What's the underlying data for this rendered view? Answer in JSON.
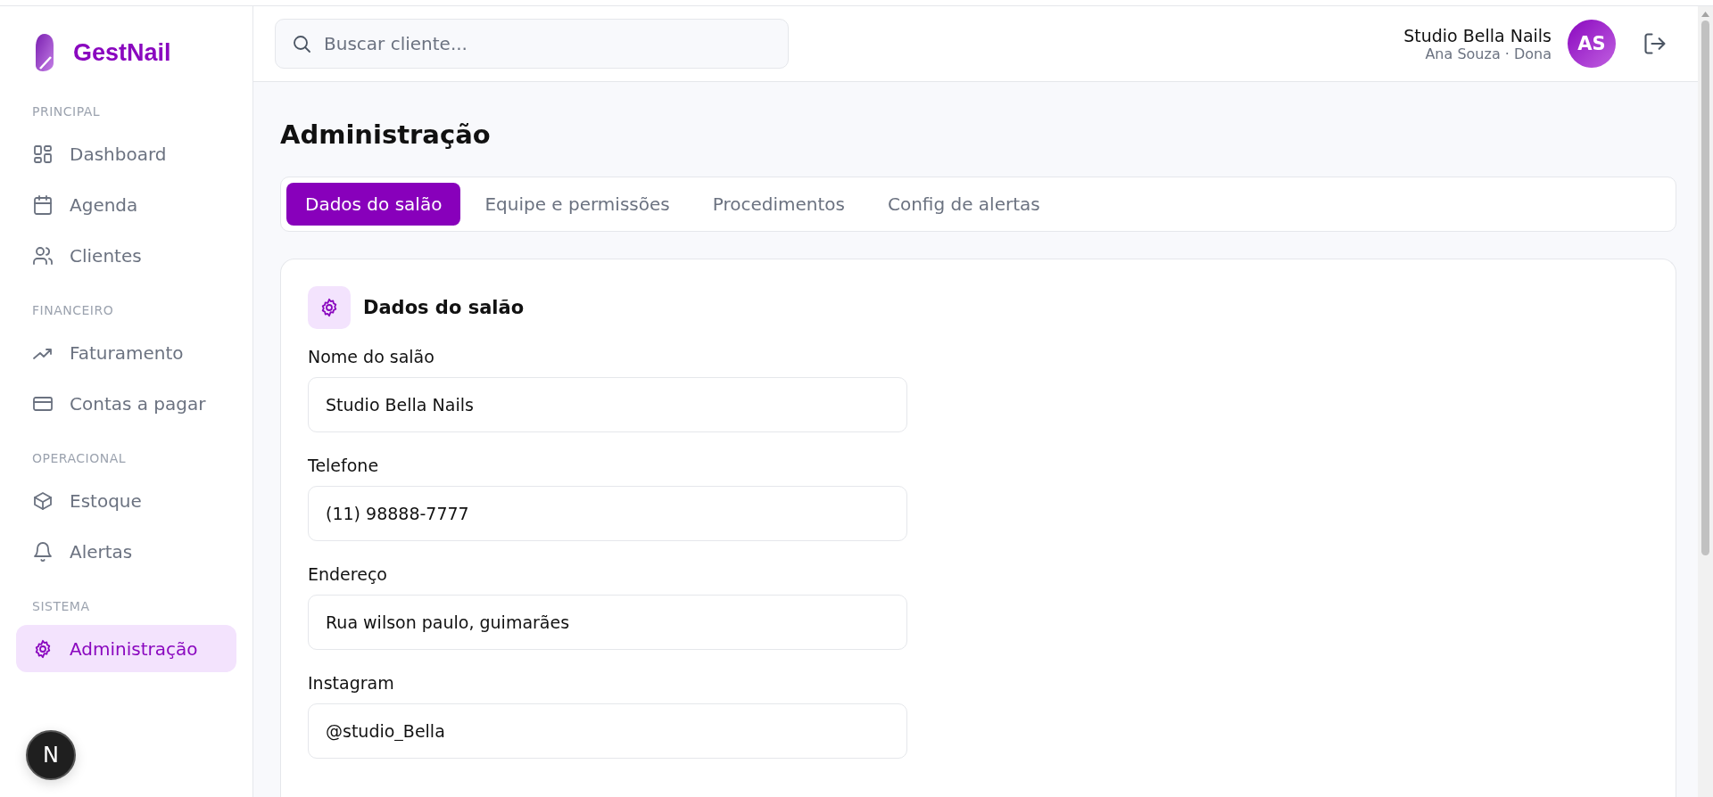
{
  "brand": {
    "name": "GestNail"
  },
  "sidebar": {
    "sections": [
      {
        "title": "PRINCIPAL",
        "items": [
          {
            "label": "Dashboard",
            "selected": false
          },
          {
            "label": "Agenda",
            "selected": false
          },
          {
            "label": "Clientes",
            "selected": false
          }
        ]
      },
      {
        "title": "FINANCEIRO",
        "items": [
          {
            "label": "Faturamento",
            "selected": false
          },
          {
            "label": "Contas a pagar",
            "selected": false
          }
        ]
      },
      {
        "title": "OPERACIONAL",
        "items": [
          {
            "label": "Estoque",
            "selected": false
          },
          {
            "label": "Alertas",
            "selected": false
          }
        ]
      },
      {
        "title": "SISTEMA",
        "items": [
          {
            "label": "Administração",
            "selected": true
          }
        ]
      }
    ],
    "badge": "N"
  },
  "header": {
    "search": {
      "placeholder": "Buscar cliente..."
    },
    "salon": "Studio Bella Nails",
    "user": "Ana Souza · Dona",
    "avatar": "AS"
  },
  "page": {
    "title": "Administração"
  },
  "tabs": [
    {
      "label": "Dados do salão",
      "selected": true
    },
    {
      "label": "Equipe e permissões",
      "selected": false
    },
    {
      "label": "Procedimentos",
      "selected": false
    },
    {
      "label": "Config de alertas",
      "selected": false
    }
  ],
  "card": {
    "title": "Dados do salão",
    "fields": [
      {
        "label": "Nome do salão",
        "value": "Studio Bella Nails"
      },
      {
        "label": "Telefone",
        "value": "(11) 98888-7777"
      },
      {
        "label": "Endereço",
        "value": "Rua wilson paulo, guimarães"
      },
      {
        "label": "Instagram",
        "value": "@studio_Bella"
      }
    ]
  }
}
